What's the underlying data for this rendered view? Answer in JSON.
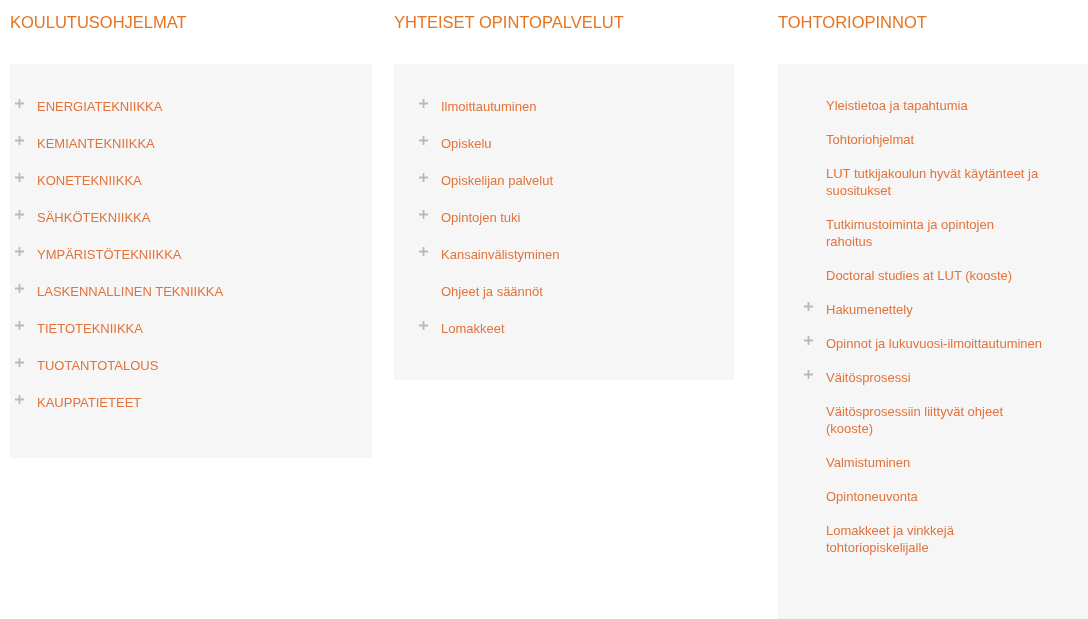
{
  "columns": [
    {
      "heading": "KOULUTUSOHJELMAT",
      "items": [
        {
          "label": "ENERGIATEKNIIKKA",
          "expandable": true
        },
        {
          "label": "KEMIANTEKNIIKKA",
          "expandable": true
        },
        {
          "label": "KONETEKNIIKKA",
          "expandable": true
        },
        {
          "label": "SÄHKÖTEKNIIKKA",
          "expandable": true
        },
        {
          "label": "YMPÄRISTÖTEKNIIKKA",
          "expandable": true
        },
        {
          "label": "LASKENNALLINEN TEKNIIKKA",
          "expandable": true
        },
        {
          "label": "TIETOTEKNIIKKA",
          "expandable": true
        },
        {
          "label": "TUOTANTOTALOUS",
          "expandable": true
        },
        {
          "label": "KAUPPATIETEET",
          "expandable": true
        }
      ]
    },
    {
      "heading": "YHTEISET OPINTOPALVELUT",
      "items": [
        {
          "label": "Ilmoittautuminen",
          "expandable": true
        },
        {
          "label": "Opiskelu",
          "expandable": true
        },
        {
          "label": "Opiskelijan palvelut",
          "expandable": true
        },
        {
          "label": "Opintojen tuki",
          "expandable": true
        },
        {
          "label": "Kansainvälistyminen",
          "expandable": true
        },
        {
          "label": "Ohjeet ja säännöt",
          "expandable": false
        },
        {
          "label": "Lomakkeet",
          "expandable": true
        }
      ]
    },
    {
      "heading": "TOHTORIOPINNOT",
      "items": [
        {
          "label": "Yleistietoa ja tapahtumia",
          "expandable": false
        },
        {
          "label": "Tohtoriohjelmat",
          "expandable": false
        },
        {
          "label": "LUT tutkijakoulun hyvät käytänteet ja suositukset",
          "expandable": false
        },
        {
          "label": "Tutkimustoiminta ja opintojen rahoitus",
          "expandable": false
        },
        {
          "label": "Doctoral studies at LUT (kooste)",
          "expandable": false
        },
        {
          "label": "Hakumenettely",
          "expandable": true
        },
        {
          "label": "Opinnot ja lukuvuosi-ilmoittautuminen",
          "expandable": true
        },
        {
          "label": "Väitösprosessi",
          "expandable": true
        },
        {
          "label": "Väitösprosessiin liittyvät ohjeet (kooste)",
          "expandable": false
        },
        {
          "label": "Valmistuminen",
          "expandable": false
        },
        {
          "label": "Opintoneuvonta",
          "expandable": false
        },
        {
          "label": "Lomakkeet ja vinkkejä tohtoriopiskelijalle",
          "expandable": false
        }
      ]
    }
  ]
}
